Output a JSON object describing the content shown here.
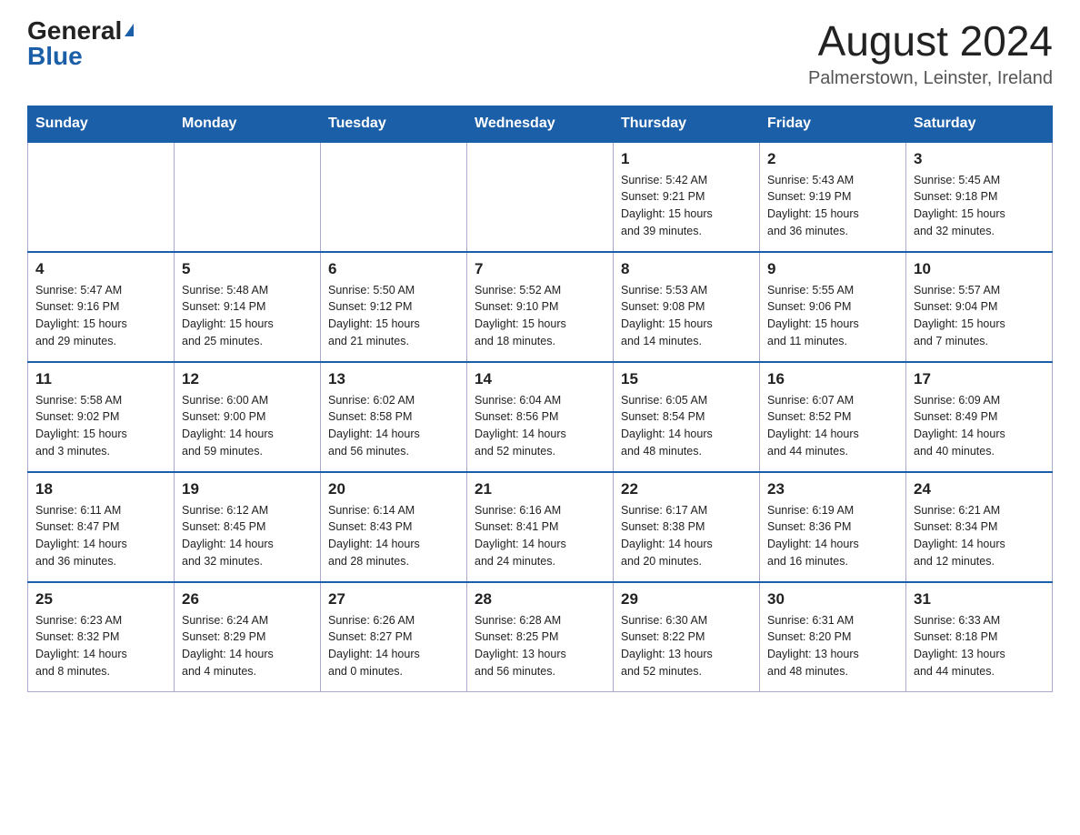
{
  "header": {
    "logo_general": "General",
    "logo_blue": "Blue",
    "month_year": "August 2024",
    "location": "Palmerstown, Leinster, Ireland"
  },
  "days_of_week": [
    "Sunday",
    "Monday",
    "Tuesday",
    "Wednesday",
    "Thursday",
    "Friday",
    "Saturday"
  ],
  "weeks": [
    [
      {
        "day": "",
        "info": ""
      },
      {
        "day": "",
        "info": ""
      },
      {
        "day": "",
        "info": ""
      },
      {
        "day": "",
        "info": ""
      },
      {
        "day": "1",
        "info": "Sunrise: 5:42 AM\nSunset: 9:21 PM\nDaylight: 15 hours\nand 39 minutes."
      },
      {
        "day": "2",
        "info": "Sunrise: 5:43 AM\nSunset: 9:19 PM\nDaylight: 15 hours\nand 36 minutes."
      },
      {
        "day": "3",
        "info": "Sunrise: 5:45 AM\nSunset: 9:18 PM\nDaylight: 15 hours\nand 32 minutes."
      }
    ],
    [
      {
        "day": "4",
        "info": "Sunrise: 5:47 AM\nSunset: 9:16 PM\nDaylight: 15 hours\nand 29 minutes."
      },
      {
        "day": "5",
        "info": "Sunrise: 5:48 AM\nSunset: 9:14 PM\nDaylight: 15 hours\nand 25 minutes."
      },
      {
        "day": "6",
        "info": "Sunrise: 5:50 AM\nSunset: 9:12 PM\nDaylight: 15 hours\nand 21 minutes."
      },
      {
        "day": "7",
        "info": "Sunrise: 5:52 AM\nSunset: 9:10 PM\nDaylight: 15 hours\nand 18 minutes."
      },
      {
        "day": "8",
        "info": "Sunrise: 5:53 AM\nSunset: 9:08 PM\nDaylight: 15 hours\nand 14 minutes."
      },
      {
        "day": "9",
        "info": "Sunrise: 5:55 AM\nSunset: 9:06 PM\nDaylight: 15 hours\nand 11 minutes."
      },
      {
        "day": "10",
        "info": "Sunrise: 5:57 AM\nSunset: 9:04 PM\nDaylight: 15 hours\nand 7 minutes."
      }
    ],
    [
      {
        "day": "11",
        "info": "Sunrise: 5:58 AM\nSunset: 9:02 PM\nDaylight: 15 hours\nand 3 minutes."
      },
      {
        "day": "12",
        "info": "Sunrise: 6:00 AM\nSunset: 9:00 PM\nDaylight: 14 hours\nand 59 minutes."
      },
      {
        "day": "13",
        "info": "Sunrise: 6:02 AM\nSunset: 8:58 PM\nDaylight: 14 hours\nand 56 minutes."
      },
      {
        "day": "14",
        "info": "Sunrise: 6:04 AM\nSunset: 8:56 PM\nDaylight: 14 hours\nand 52 minutes."
      },
      {
        "day": "15",
        "info": "Sunrise: 6:05 AM\nSunset: 8:54 PM\nDaylight: 14 hours\nand 48 minutes."
      },
      {
        "day": "16",
        "info": "Sunrise: 6:07 AM\nSunset: 8:52 PM\nDaylight: 14 hours\nand 44 minutes."
      },
      {
        "day": "17",
        "info": "Sunrise: 6:09 AM\nSunset: 8:49 PM\nDaylight: 14 hours\nand 40 minutes."
      }
    ],
    [
      {
        "day": "18",
        "info": "Sunrise: 6:11 AM\nSunset: 8:47 PM\nDaylight: 14 hours\nand 36 minutes."
      },
      {
        "day": "19",
        "info": "Sunrise: 6:12 AM\nSunset: 8:45 PM\nDaylight: 14 hours\nand 32 minutes."
      },
      {
        "day": "20",
        "info": "Sunrise: 6:14 AM\nSunset: 8:43 PM\nDaylight: 14 hours\nand 28 minutes."
      },
      {
        "day": "21",
        "info": "Sunrise: 6:16 AM\nSunset: 8:41 PM\nDaylight: 14 hours\nand 24 minutes."
      },
      {
        "day": "22",
        "info": "Sunrise: 6:17 AM\nSunset: 8:38 PM\nDaylight: 14 hours\nand 20 minutes."
      },
      {
        "day": "23",
        "info": "Sunrise: 6:19 AM\nSunset: 8:36 PM\nDaylight: 14 hours\nand 16 minutes."
      },
      {
        "day": "24",
        "info": "Sunrise: 6:21 AM\nSunset: 8:34 PM\nDaylight: 14 hours\nand 12 minutes."
      }
    ],
    [
      {
        "day": "25",
        "info": "Sunrise: 6:23 AM\nSunset: 8:32 PM\nDaylight: 14 hours\nand 8 minutes."
      },
      {
        "day": "26",
        "info": "Sunrise: 6:24 AM\nSunset: 8:29 PM\nDaylight: 14 hours\nand 4 minutes."
      },
      {
        "day": "27",
        "info": "Sunrise: 6:26 AM\nSunset: 8:27 PM\nDaylight: 14 hours\nand 0 minutes."
      },
      {
        "day": "28",
        "info": "Sunrise: 6:28 AM\nSunset: 8:25 PM\nDaylight: 13 hours\nand 56 minutes."
      },
      {
        "day": "29",
        "info": "Sunrise: 6:30 AM\nSunset: 8:22 PM\nDaylight: 13 hours\nand 52 minutes."
      },
      {
        "day": "30",
        "info": "Sunrise: 6:31 AM\nSunset: 8:20 PM\nDaylight: 13 hours\nand 48 minutes."
      },
      {
        "day": "31",
        "info": "Sunrise: 6:33 AM\nSunset: 8:18 PM\nDaylight: 13 hours\nand 44 minutes."
      }
    ]
  ]
}
